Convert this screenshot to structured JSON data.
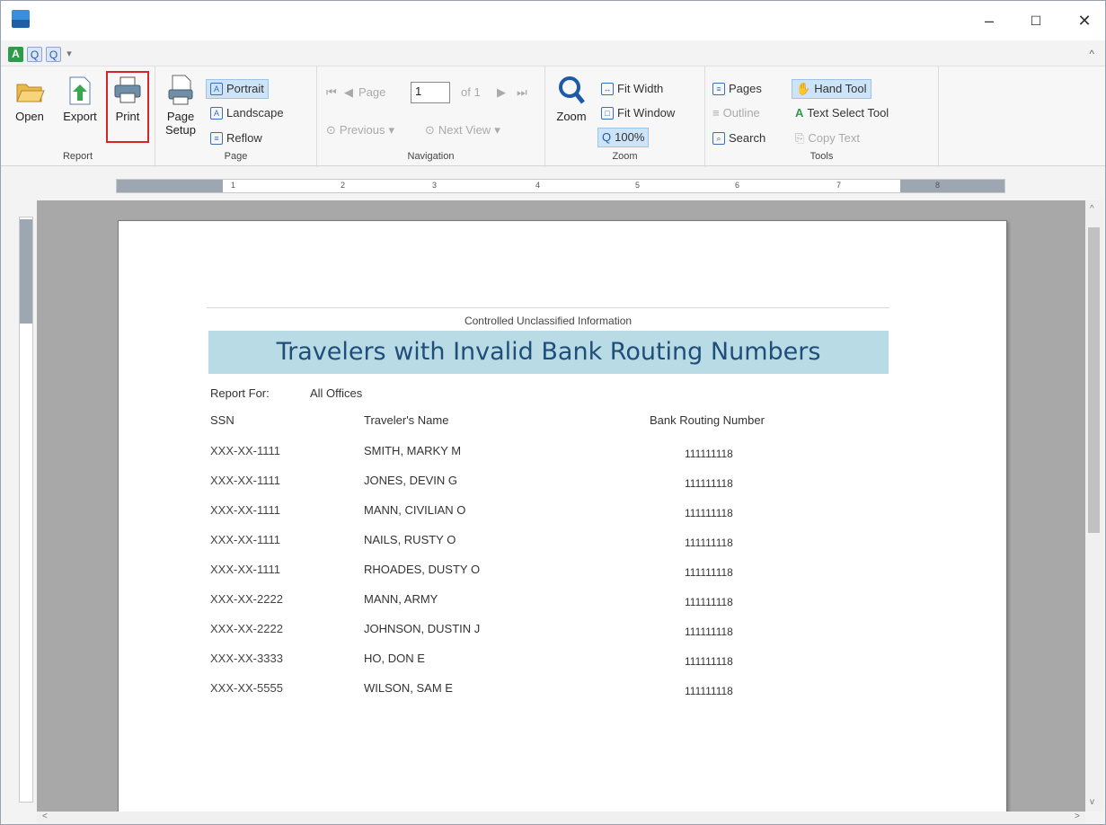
{
  "window": {
    "minimize": "–",
    "maximize": "☐",
    "close": "✕"
  },
  "quick_access": {
    "items": [
      "A",
      "Q",
      "Q"
    ],
    "dropdown": "▾"
  },
  "ribbon": {
    "collapse": "^",
    "report": {
      "label": "Report",
      "open": "Open",
      "export": "Export",
      "print": "Print"
    },
    "page": {
      "label": "Page",
      "setup_line1": "Page",
      "setup_line2": "Setup",
      "portrait": "Portrait",
      "landscape": "Landscape",
      "reflow": "Reflow"
    },
    "navigation": {
      "label": "Navigation",
      "page_label": "Page",
      "page_value": "1",
      "of": "of 1",
      "previous": "Previous",
      "next_view": "Next View"
    },
    "zoom": {
      "label": "Zoom",
      "zoom": "Zoom",
      "fit_width": "Fit Width",
      "fit_window": "Fit Window",
      "percent": "100%"
    },
    "tools": {
      "label": "Tools",
      "pages": "Pages",
      "outline": "Outline",
      "search": "Search",
      "hand_tool": "Hand Tool",
      "text_select": "Text Select Tool",
      "copy_text": "Copy Text"
    }
  },
  "ruler": {
    "ticks": [
      "1",
      "2",
      "3",
      "4",
      "5",
      "6",
      "7",
      "8"
    ]
  },
  "report": {
    "cui": "Controlled Unclassified Information",
    "title": "Travelers with Invalid Bank Routing Numbers",
    "report_for_label": "Report For:",
    "report_for_value": "All Offices",
    "headers": {
      "ssn": "SSN",
      "name": "Traveler's Name",
      "routing": "Bank Routing Number"
    },
    "rows": [
      {
        "ssn": "XXX-XX-1111",
        "name": "SMITH, MARKY M",
        "routing": "111111118"
      },
      {
        "ssn": "XXX-XX-1111",
        "name": "JONES, DEVIN G",
        "routing": "111111118"
      },
      {
        "ssn": "XXX-XX-1111",
        "name": "MANN, CIVILIAN O",
        "routing": "111111118"
      },
      {
        "ssn": "XXX-XX-1111",
        "name": "NAILS, RUSTY O",
        "routing": "111111118"
      },
      {
        "ssn": "XXX-XX-1111",
        "name": "RHOADES, DUSTY O",
        "routing": "111111118"
      },
      {
        "ssn": "XXX-XX-2222",
        "name": "MANN, ARMY",
        "routing": "111111118"
      },
      {
        "ssn": "XXX-XX-2222",
        "name": "JOHNSON, DUSTIN J",
        "routing": "111111118"
      },
      {
        "ssn": "XXX-XX-3333",
        "name": "HO, DON E",
        "routing": "111111118"
      },
      {
        "ssn": "XXX-XX-5555",
        "name": "WILSON, SAM E",
        "routing": "111111118"
      }
    ]
  },
  "colors": {
    "banner": "#b9dbe6",
    "title": "#1f4e79",
    "highlight": "#d4252b",
    "selected": "#cde3f7"
  }
}
